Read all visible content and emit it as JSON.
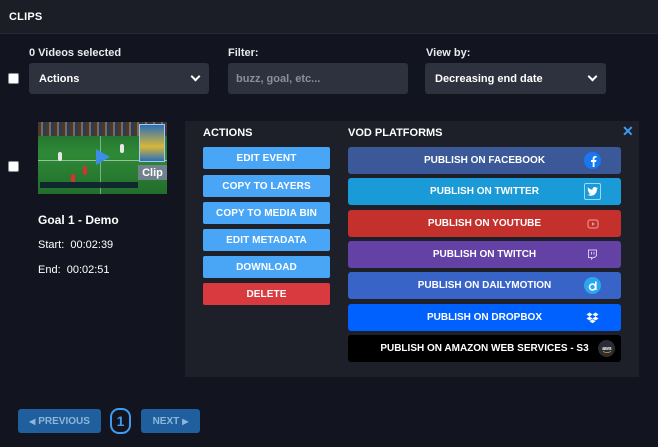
{
  "header": {
    "title": "CLIPS"
  },
  "toolbar": {
    "selected_count": "0 Videos selected",
    "actions_select": "Actions",
    "filter_label": "Filter:",
    "filter_placeholder": "buzz, goal, etc...",
    "viewby_label": "View by:",
    "viewby_select": "Decreasing end date"
  },
  "clip": {
    "badge": "Clip",
    "title": "Goal 1 - Demo",
    "start_label": "Start:",
    "start_value": "00:02:39",
    "end_label": "End:",
    "end_value": "00:02:51"
  },
  "actions": {
    "heading": "ACTIONS",
    "items": [
      {
        "label": "EDIT EVENT"
      },
      {
        "label": "COPY TO LAYERS"
      },
      {
        "label": "COPY TO MEDIA BIN"
      },
      {
        "label": "EDIT METADATA"
      },
      {
        "label": "DOWNLOAD"
      },
      {
        "label": "DELETE"
      }
    ]
  },
  "platforms": {
    "heading": "VOD PLATFORMS",
    "items": [
      {
        "label": "PUBLISH ON FACEBOOK",
        "color": "#3b5998",
        "icon": "facebook-icon"
      },
      {
        "label": "PUBLISH ON TWITTER",
        "color": "#1a9bd7",
        "icon": "twitter-icon"
      },
      {
        "label": "PUBLISH ON YOUTUBE",
        "color": "#c4302b",
        "icon": "youtube-icon"
      },
      {
        "label": "PUBLISH ON TWITCH",
        "color": "#6441a5",
        "icon": "twitch-icon"
      },
      {
        "label": "PUBLISH ON DAILYMOTION",
        "color": "#3863c7",
        "icon": "dailymotion-icon"
      },
      {
        "label": "PUBLISH ON DROPBOX",
        "color": "#0061fe",
        "icon": "dropbox-icon"
      },
      {
        "label": "PUBLISH ON AMAZON WEB SERVICES - S3",
        "color": "#000000",
        "icon": "aws-icon"
      }
    ]
  },
  "pagination": {
    "previous_label": "PREVIOUS",
    "next_label": "NEXT",
    "current_page": "1"
  },
  "colors": {
    "accent": "#3f9bf0",
    "action_button": "#49a6f7",
    "delete_button": "#d83a3f",
    "background": "#121520",
    "panel": "#1d2028"
  }
}
